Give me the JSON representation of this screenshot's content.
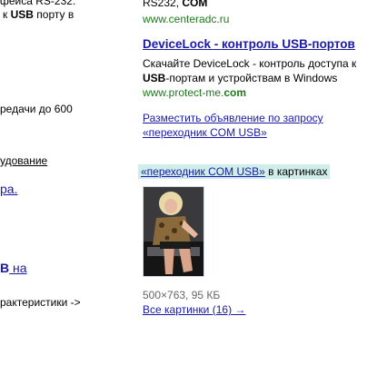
{
  "left_column": {
    "line1": "фейса RS-232.",
    "line2_pre": "к ",
    "line2_bold": "USB",
    "line2_post": " порту в",
    "line3": "редачи до 600",
    "line4": "удование",
    "line5": "ра.",
    "line6_bold": "В",
    "line6_link": " на",
    "line7": "рактеристики ->"
  },
  "ad1": {
    "text_pre": "RS232, ",
    "text_bold": "COM",
    "url": "www.centeradc.ru"
  },
  "ad2": {
    "title": "DeviceLock - контроль USB-портов",
    "desc_line1": "Скачайте DeviceLock - контроль доступа к",
    "desc_line2_bold": "USB",
    "desc_line2_rest": "-портам и устройствам в Windows",
    "url_pre": "www.protect-me.",
    "url_bold": "com"
  },
  "place_ad": {
    "line1": "Разместить объявление по запросу",
    "line2": "«переходник COM USB»"
  },
  "images_block": {
    "heading_query": "«переходник COM USB»",
    "heading_rest": " в картинках",
    "image_info": "500×763, 95 КБ",
    "all_images_link": "Все картинки (16) →"
  }
}
